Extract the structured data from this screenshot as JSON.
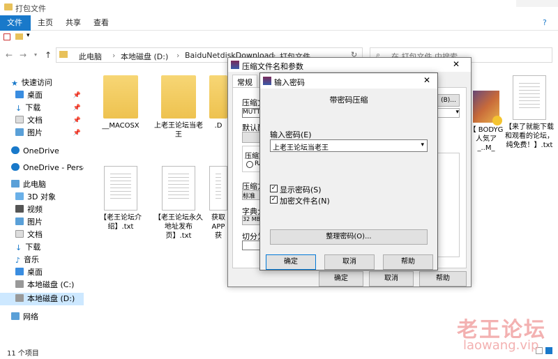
{
  "window": {
    "title": "打包文件"
  },
  "ribbon": {
    "tabs": [
      "文件",
      "主页",
      "共享",
      "查看"
    ]
  },
  "address": {
    "crumbs": [
      "此电脑",
      "本地磁盘 (D:)",
      "BaiduNetdiskDownload",
      "打包文件"
    ],
    "search_placeholder": "在 打包文件 中搜索"
  },
  "sidebar": {
    "items": [
      {
        "label": "快速访问"
      },
      {
        "label": "桌面"
      },
      {
        "label": "下载"
      },
      {
        "label": "文档"
      },
      {
        "label": "图片"
      },
      {
        "label": "OneDrive"
      },
      {
        "label": "OneDrive - Persona"
      },
      {
        "label": "此电脑"
      },
      {
        "label": "3D 对象"
      },
      {
        "label": "视频"
      },
      {
        "label": "图片"
      },
      {
        "label": "文档"
      },
      {
        "label": "下载"
      },
      {
        "label": "音乐"
      },
      {
        "label": "桌面"
      },
      {
        "label": "本地磁盘 (C:)"
      },
      {
        "label": "本地磁盘 (D:)"
      },
      {
        "label": "网络"
      }
    ]
  },
  "files": [
    {
      "name": "__MACOSX",
      "type": "folder"
    },
    {
      "name": "上老王论坛当老王",
      "type": "folder"
    },
    {
      "name": ".D",
      "type": "folder"
    },
    {
      "name": "【老王论坛介绍】.txt",
      "type": "doc"
    },
    {
      "name": "【老王论坛永久地址发布页】.txt",
      "type": "doc"
    },
    {
      "name": "获取APP 获",
      "type": "doc"
    },
    {
      "name": "【 BODYG 人気ア_..M_",
      "type": "video"
    },
    {
      "name": "【来了就能下载和观看的论坛，纯免费！】.txt",
      "type": "doc"
    }
  ],
  "status": {
    "count": "11 个项目"
  },
  "archive_dialog": {
    "title": "压缩文件名和参数",
    "tab": "常规",
    "labels": {
      "archive_name": "压缩文",
      "archive_value": "MUTTO",
      "default": "默认配",
      "format": "压缩文",
      "format_opt": "RA",
      "method": "压缩方",
      "method_value": "标准",
      "dict": "字典大",
      "dict_value": "32 MB",
      "split": "切分为",
      "browse": "(B)..."
    },
    "buttons": {
      "ok": "确定",
      "cancel": "取消",
      "help": "帮助"
    }
  },
  "password_dialog": {
    "title": "输入密码",
    "heading": "带密码压缩",
    "password_label": "输入密码(E)",
    "password_value": "上老王论坛当老王",
    "show_password": "显示密码(S)",
    "encrypt_names": "加密文件名(N)",
    "organize": "整理密码(O)...",
    "buttons": {
      "ok": "确定",
      "cancel": "取消",
      "help": "帮助"
    }
  },
  "watermark": {
    "cn": "老王论坛",
    "en": "laowang.vip"
  }
}
